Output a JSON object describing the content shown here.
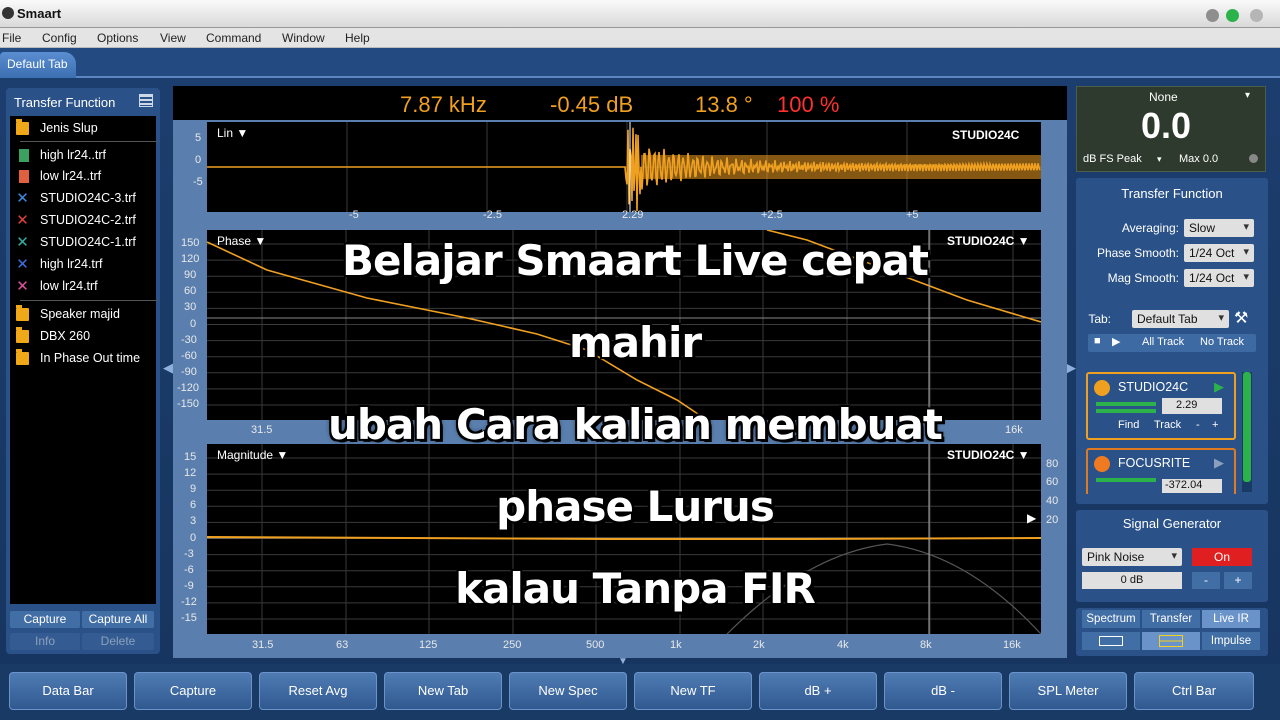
{
  "window": {
    "title": "Smaart"
  },
  "menu": [
    "File",
    "Config",
    "Options",
    "View",
    "Command",
    "Window",
    "Help"
  ],
  "tabs": [
    {
      "label": "Default Tab"
    }
  ],
  "left_panel": {
    "title": "Transfer Function",
    "items": [
      {
        "label": "Jenis Slup",
        "icon": "folder-icon",
        "color": "#f0a818"
      },
      {
        "label": "high lr24..trf",
        "icon": "file-icon",
        "color": "#3ca060"
      },
      {
        "label": "low lr24..trf",
        "icon": "file-icon",
        "color": "#e06040"
      },
      {
        "label": "STUDIO24C-3.trf",
        "icon": "x-icon",
        "color": "#3a8ae0"
      },
      {
        "label": "STUDIO24C-2.trf",
        "icon": "x-icon",
        "color": "#e04040"
      },
      {
        "label": "STUDIO24C-1.trf",
        "icon": "x-icon",
        "color": "#30b0a0"
      },
      {
        "label": "high lr24.trf",
        "icon": "x-icon",
        "color": "#3a70e0"
      },
      {
        "label": "low lr24.trf",
        "icon": "x-icon",
        "color": "#e050a0"
      },
      {
        "label": "Speaker majid",
        "icon": "folder-icon",
        "color": "#f0a818"
      },
      {
        "label": "DBX 260",
        "icon": "folder-icon",
        "color": "#f0a818"
      },
      {
        "label": "In Phase Out time",
        "icon": "folder-icon",
        "color": "#f0a818"
      }
    ],
    "buttons": {
      "capture": "Capture",
      "capture_all": "Capture All",
      "info": "Info",
      "delete": "Delete"
    }
  },
  "readout": {
    "freq": "7.87 kHz",
    "mag": "-0.45 dB",
    "phase": "13.8 °",
    "coherence": "100 %"
  },
  "plots": {
    "ir": {
      "title": "Lin ▼",
      "source": "STUDIO24C",
      "y_ticks": [
        "5",
        "0",
        "-5"
      ],
      "x_ticks": [
        "-5",
        "-2.5",
        "2.29",
        "+2.5",
        "+5"
      ]
    },
    "phase": {
      "title": "Phase ▼",
      "source": "STUDIO24C ▼",
      "y_ticks": [
        "150",
        "120",
        "90",
        "60",
        "30",
        "0",
        "-30",
        "-60",
        "-90",
        "-120",
        "-150"
      ],
      "x_ticks": [
        "31.5",
        "16k"
      ]
    },
    "magnitude": {
      "title": "Magnitude ▼",
      "source": "STUDIO24C ▼",
      "y_ticks": [
        "15",
        "12",
        "9",
        "6",
        "3",
        "0",
        "-3",
        "-6",
        "-9",
        "-12",
        "-15"
      ],
      "right_ticks": [
        "80",
        "60",
        "40",
        "20"
      ],
      "x_ticks": [
        "31.5",
        "63",
        "125",
        "250",
        "500",
        "1k",
        "2k",
        "4k",
        "8k",
        "16k"
      ]
    }
  },
  "meter": {
    "source": "None",
    "value": "0.0",
    "unit": "dB FS Peak",
    "max": "Max 0.0"
  },
  "tf_settings": {
    "title": "Transfer Function",
    "averaging_label": "Averaging:",
    "averaging": "Slow",
    "phase_smooth_label": "Phase Smooth:",
    "phase_smooth": "1/24 Oct",
    "mag_smooth_label": "Mag Smooth:",
    "mag_smooth": "1/24 Oct",
    "tab_label": "Tab:",
    "tab": "Default Tab",
    "all_track": "All Track",
    "no_track": "No Track"
  },
  "tracks": [
    {
      "name": "STUDIO24C",
      "delay": "2.29",
      "find": "Find",
      "track": "Track",
      "minus": "-",
      "plus": "+"
    },
    {
      "name": "FOCUSRITE",
      "delay": "-372.04"
    }
  ],
  "signal_generator": {
    "title": "Signal Generator",
    "type": "Pink Noise",
    "state": "On",
    "level": "0 dB",
    "minus": "-",
    "plus": "+"
  },
  "view_modes": {
    "spectrum": "Spectrum",
    "transfer": "Transfer",
    "live_ir": "Live IR",
    "impulse": "Impulse"
  },
  "bottom_buttons": [
    "Data Bar",
    "Capture",
    "Reset Avg",
    "New Tab",
    "New Spec",
    "New TF",
    "dB +",
    "dB -",
    "SPL Meter",
    "Ctrl Bar"
  ],
  "overlay": [
    "Belajar Smaart Live cepat",
    "mahir",
    "ubah Cara kalian membuat",
    "phase Lurus",
    "kalau Tanpa FIR"
  ],
  "colors": {
    "trace": "#f0a020",
    "grid": "#3a3a3a",
    "accent_red": "#ff3030",
    "panel": "#2a5288"
  }
}
